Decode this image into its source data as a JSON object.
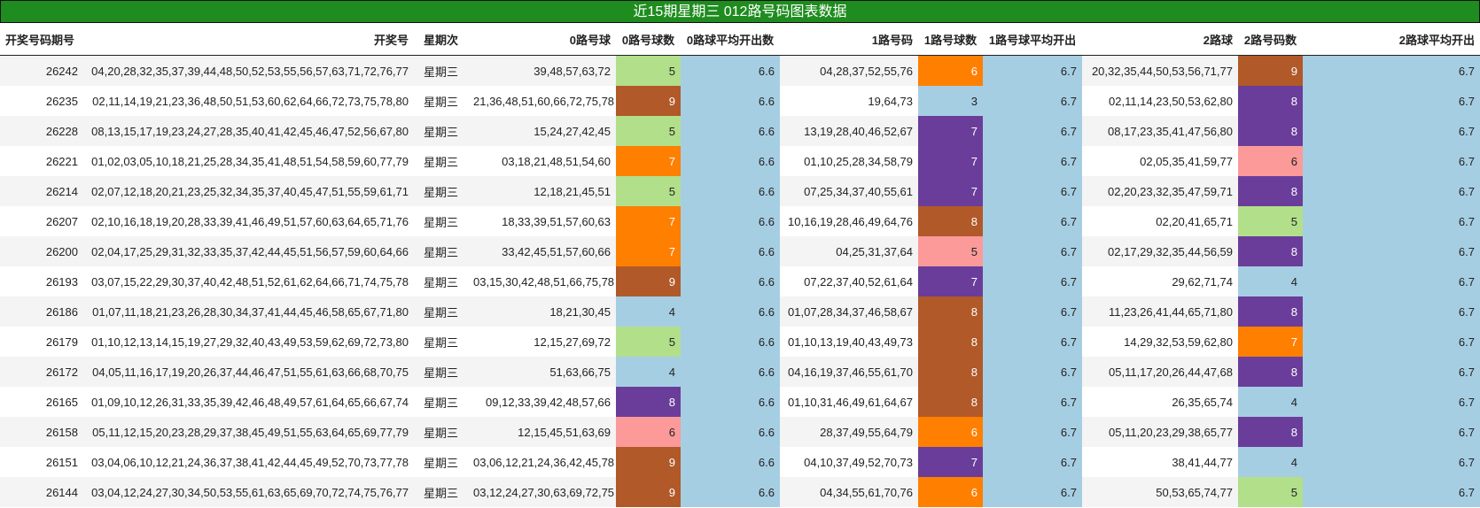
{
  "title": "近15期星期三 012路号码图表数据",
  "headers": [
    "开奖号码期号",
    "开奖号",
    "星期次",
    "0路号球",
    "0路号球数",
    "0路球平均开出数",
    "1路号码",
    "1路号球数",
    "1路号球平均开出",
    "2路球",
    "2路号码数",
    "2路球平均开出"
  ],
  "colors": {
    "4": "#a6cee3",
    "3": "#a6cee3",
    "5": "#b2df8a",
    "6": "#fb9a99",
    "6o": "#ff7f00",
    "7": "#ff7f00",
    "7p": "#6a3d9a",
    "8": "#6a3d9a",
    "8b": "#b15928",
    "9": "#b15928",
    "avg": "#a6cee3",
    "title_bg": "#1e8c1e"
  },
  "rows": [
    {
      "issue": "26242",
      "nums": "04,20,28,32,35,37,39,44,48,50,52,53,55,56,57,63,71,72,76,77",
      "week": "星期三",
      "r0": "39,48,57,63,72",
      "c0": "5",
      "c0color": "#b2df8a",
      "a0": "6.6",
      "r1": "04,28,37,52,55,76",
      "c1": "6",
      "c1color": "#ff7f00",
      "a1": "6.7",
      "r2": "20,32,35,44,50,53,56,71,77",
      "c2": "9",
      "c2color": "#b15928",
      "a2": "6.7"
    },
    {
      "issue": "26235",
      "nums": "02,11,14,19,21,23,36,48,50,51,53,60,62,64,66,72,73,75,78,80",
      "week": "星期三",
      "r0": "21,36,48,51,60,66,72,75,78",
      "c0": "9",
      "c0color": "#b15928",
      "a0": "6.6",
      "r1": "19,64,73",
      "c1": "3",
      "c1color": "#a6cee3",
      "a1": "6.7",
      "r2": "02,11,14,23,50,53,62,80",
      "c2": "8",
      "c2color": "#6a3d9a",
      "a2": "6.7"
    },
    {
      "issue": "26228",
      "nums": "08,13,15,17,19,23,24,27,28,35,40,41,42,45,46,47,52,56,67,80",
      "week": "星期三",
      "r0": "15,24,27,42,45",
      "c0": "5",
      "c0color": "#b2df8a",
      "a0": "6.6",
      "r1": "13,19,28,40,46,52,67",
      "c1": "7",
      "c1color": "#6a3d9a",
      "a1": "6.7",
      "r2": "08,17,23,35,41,47,56,80",
      "c2": "8",
      "c2color": "#6a3d9a",
      "a2": "6.7"
    },
    {
      "issue": "26221",
      "nums": "01,02,03,05,10,18,21,25,28,34,35,41,48,51,54,58,59,60,77,79",
      "week": "星期三",
      "r0": "03,18,21,48,51,54,60",
      "c0": "7",
      "c0color": "#ff7f00",
      "a0": "6.6",
      "r1": "01,10,25,28,34,58,79",
      "c1": "7",
      "c1color": "#6a3d9a",
      "a1": "6.7",
      "r2": "02,05,35,41,59,77",
      "c2": "6",
      "c2color": "#fb9a99",
      "a2": "6.7"
    },
    {
      "issue": "26214",
      "nums": "02,07,12,18,20,21,23,25,32,34,35,37,40,45,47,51,55,59,61,71",
      "week": "星期三",
      "r0": "12,18,21,45,51",
      "c0": "5",
      "c0color": "#b2df8a",
      "a0": "6.6",
      "r1": "07,25,34,37,40,55,61",
      "c1": "7",
      "c1color": "#6a3d9a",
      "a1": "6.7",
      "r2": "02,20,23,32,35,47,59,71",
      "c2": "8",
      "c2color": "#6a3d9a",
      "a2": "6.7"
    },
    {
      "issue": "26207",
      "nums": "02,10,16,18,19,20,28,33,39,41,46,49,51,57,60,63,64,65,71,76",
      "week": "星期三",
      "r0": "18,33,39,51,57,60,63",
      "c0": "7",
      "c0color": "#ff7f00",
      "a0": "6.6",
      "r1": "10,16,19,28,46,49,64,76",
      "c1": "8",
      "c1color": "#b15928",
      "a1": "6.7",
      "r2": "02,20,41,65,71",
      "c2": "5",
      "c2color": "#b2df8a",
      "a2": "6.7"
    },
    {
      "issue": "26200",
      "nums": "02,04,17,25,29,31,32,33,35,37,42,44,45,51,56,57,59,60,64,66",
      "week": "星期三",
      "r0": "33,42,45,51,57,60,66",
      "c0": "7",
      "c0color": "#ff7f00",
      "a0": "6.6",
      "r1": "04,25,31,37,64",
      "c1": "5",
      "c1color": "#fb9a99",
      "a1": "6.7",
      "r2": "02,17,29,32,35,44,56,59",
      "c2": "8",
      "c2color": "#6a3d9a",
      "a2": "6.7"
    },
    {
      "issue": "26193",
      "nums": "03,07,15,22,29,30,37,40,42,48,51,52,61,62,64,66,71,74,75,78",
      "week": "星期三",
      "r0": "03,15,30,42,48,51,66,75,78",
      "c0": "9",
      "c0color": "#b15928",
      "a0": "6.6",
      "r1": "07,22,37,40,52,61,64",
      "c1": "7",
      "c1color": "#6a3d9a",
      "a1": "6.7",
      "r2": "29,62,71,74",
      "c2": "4",
      "c2color": "#a6cee3",
      "a2": "6.7"
    },
    {
      "issue": "26186",
      "nums": "01,07,11,18,21,23,26,28,30,34,37,41,44,45,46,58,65,67,71,80",
      "week": "星期三",
      "r0": "18,21,30,45",
      "c0": "4",
      "c0color": "#a6cee3",
      "a0": "6.6",
      "r1": "01,07,28,34,37,46,58,67",
      "c1": "8",
      "c1color": "#b15928",
      "a1": "6.7",
      "r2": "11,23,26,41,44,65,71,80",
      "c2": "8",
      "c2color": "#6a3d9a",
      "a2": "6.7"
    },
    {
      "issue": "26179",
      "nums": "01,10,12,13,14,15,19,27,29,32,40,43,49,53,59,62,69,72,73,80",
      "week": "星期三",
      "r0": "12,15,27,69,72",
      "c0": "5",
      "c0color": "#b2df8a",
      "a0": "6.6",
      "r1": "01,10,13,19,40,43,49,73",
      "c1": "8",
      "c1color": "#b15928",
      "a1": "6.7",
      "r2": "14,29,32,53,59,62,80",
      "c2": "7",
      "c2color": "#ff7f00",
      "a2": "6.7"
    },
    {
      "issue": "26172",
      "nums": "04,05,11,16,17,19,20,26,37,44,46,47,51,55,61,63,66,68,70,75",
      "week": "星期三",
      "r0": "51,63,66,75",
      "c0": "4",
      "c0color": "#a6cee3",
      "a0": "6.6",
      "r1": "04,16,19,37,46,55,61,70",
      "c1": "8",
      "c1color": "#b15928",
      "a1": "6.7",
      "r2": "05,11,17,20,26,44,47,68",
      "c2": "8",
      "c2color": "#6a3d9a",
      "a2": "6.7"
    },
    {
      "issue": "26165",
      "nums": "01,09,10,12,26,31,33,35,39,42,46,48,49,57,61,64,65,66,67,74",
      "week": "星期三",
      "r0": "09,12,33,39,42,48,57,66",
      "c0": "8",
      "c0color": "#6a3d9a",
      "a0": "6.6",
      "r1": "01,10,31,46,49,61,64,67",
      "c1": "8",
      "c1color": "#b15928",
      "a1": "6.7",
      "r2": "26,35,65,74",
      "c2": "4",
      "c2color": "#a6cee3",
      "a2": "6.7"
    },
    {
      "issue": "26158",
      "nums": "05,11,12,15,20,23,28,29,37,38,45,49,51,55,63,64,65,69,77,79",
      "week": "星期三",
      "r0": "12,15,45,51,63,69",
      "c0": "6",
      "c0color": "#fb9a99",
      "a0": "6.6",
      "r1": "28,37,49,55,64,79",
      "c1": "6",
      "c1color": "#ff7f00",
      "a1": "6.7",
      "r2": "05,11,20,23,29,38,65,77",
      "c2": "8",
      "c2color": "#6a3d9a",
      "a2": "6.7"
    },
    {
      "issue": "26151",
      "nums": "03,04,06,10,12,21,24,36,37,38,41,42,44,45,49,52,70,73,77,78",
      "week": "星期三",
      "r0": "03,06,12,21,24,36,42,45,78",
      "c0": "9",
      "c0color": "#b15928",
      "a0": "6.6",
      "r1": "04,10,37,49,52,70,73",
      "c1": "7",
      "c1color": "#6a3d9a",
      "a1": "6.7",
      "r2": "38,41,44,77",
      "c2": "4",
      "c2color": "#a6cee3",
      "a2": "6.7"
    },
    {
      "issue": "26144",
      "nums": "03,04,12,24,27,30,34,50,53,55,61,63,65,69,70,72,74,75,76,77",
      "week": "星期三",
      "r0": "03,12,24,27,30,63,69,72,75",
      "c0": "9",
      "c0color": "#b15928",
      "a0": "6.6",
      "r1": "04,34,55,61,70,76",
      "c1": "6",
      "c1color": "#ff7f00",
      "a1": "6.7",
      "r2": "50,53,65,74,77",
      "c2": "5",
      "c2color": "#b2df8a",
      "a2": "6.7"
    }
  ]
}
